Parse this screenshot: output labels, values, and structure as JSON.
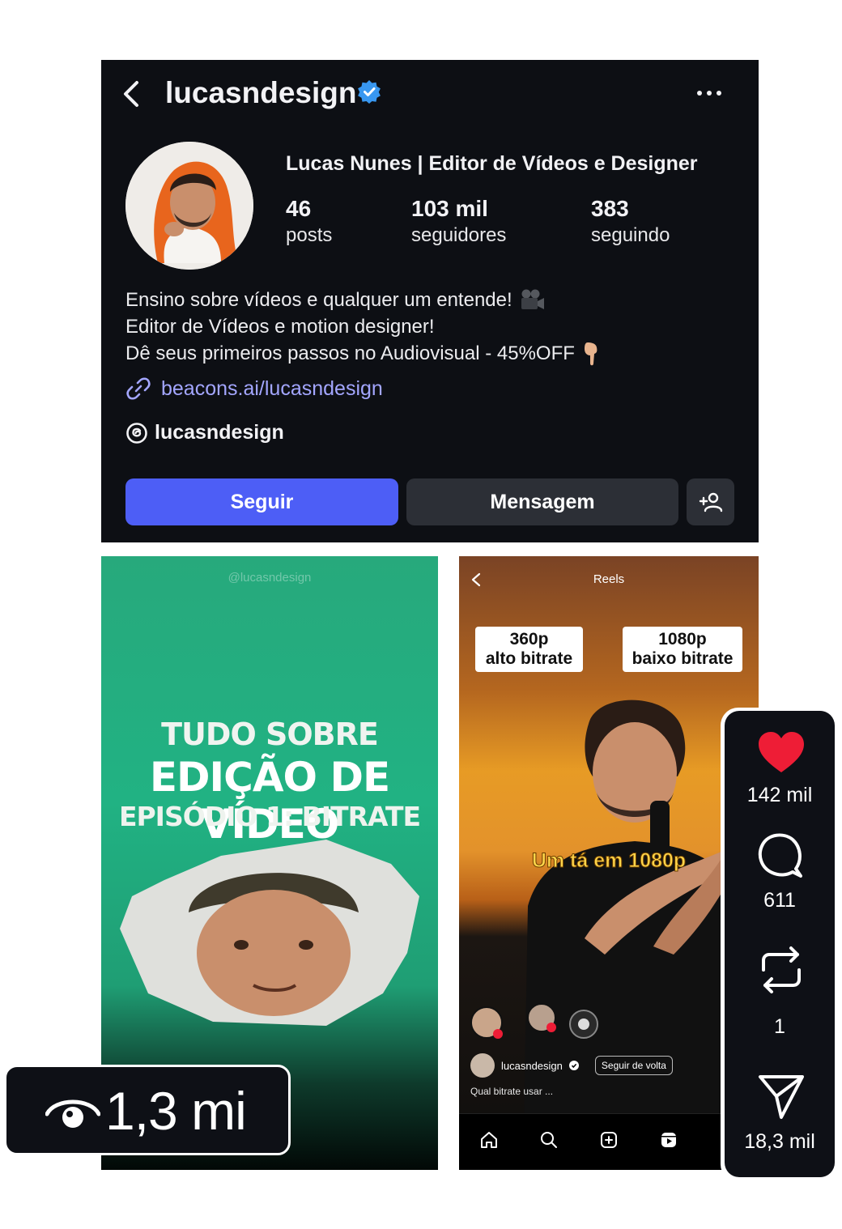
{
  "profile": {
    "handle": "lucasndesign",
    "display_name": "Lucas Nunes | Editor de Vídeos e Designer",
    "stats": [
      {
        "value": "46",
        "label": "posts"
      },
      {
        "value": "103 mil",
        "label": "seguidores"
      },
      {
        "value": "383",
        "label": "seguindo"
      }
    ],
    "bio": [
      "Ensino sobre vídeos e qualquer um entende!",
      "Editor de Vídeos e motion designer!",
      "Dê seus primeiros passos no Audiovisual - 45%OFF"
    ],
    "link": "beacons.ai/lucasndesign",
    "threads": "lucasndesign",
    "buttons": {
      "follow": "Seguir",
      "message": "Mensagem"
    },
    "accent": "#4d5ef6",
    "link_color": "#a3a6ff"
  },
  "reel_left": {
    "watermark": "@lucasndesign",
    "title_line1": "TUDO SOBRE",
    "title_line2": "EDIÇÃO DE VÍDEO",
    "title_line3": "EPISÓDIO 1: BITRATE",
    "views": "1,3 mi"
  },
  "reel_right": {
    "header": "Reels",
    "tag1_line1": "360p",
    "tag1_line2": "alto bitrate",
    "tag2_line1": "1080p",
    "tag2_line2": "baixo bitrate",
    "overlay_caption": "Um tá em 1080p",
    "username": "lucasndesign",
    "follow_back": "Seguir de volta",
    "caption": "Qual bitrate usar ..."
  },
  "actions": {
    "likes": "142 mil",
    "comments": "611",
    "reposts": "1",
    "shares": "18,3 mil",
    "like_color": "#ee1d36"
  }
}
